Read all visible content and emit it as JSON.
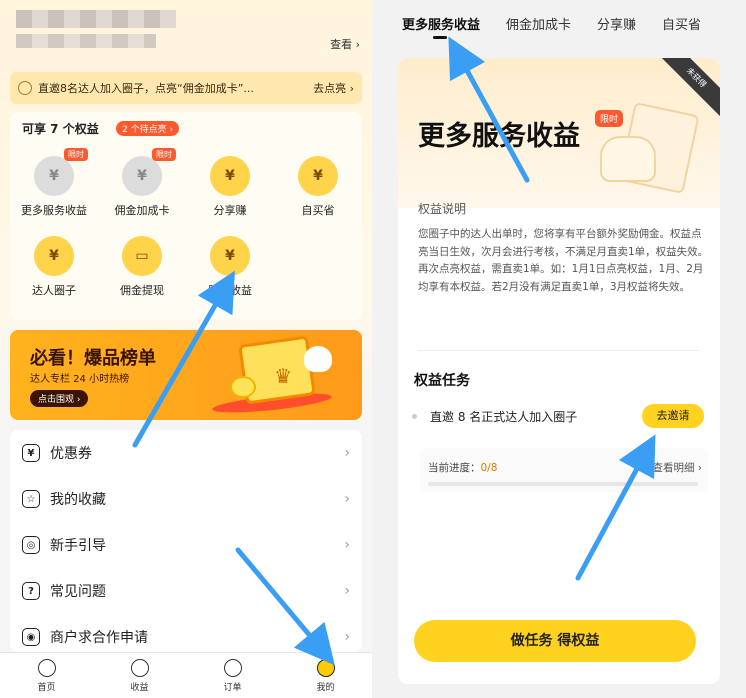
{
  "left": {
    "header": {
      "view_label": "查看 ›"
    },
    "invite_bar": {
      "text": "直邀8名达人加入圈子，点亮“佣金加成卡”...",
      "action": "去点亮 ›"
    },
    "benefits": {
      "heading": "可享 7 个权益",
      "pending_badge": "2 个待点亮 ›",
      "limited_label": "限时",
      "items": [
        {
          "label": "更多服务收益",
          "icon": "¥",
          "limited": true,
          "style": "gray"
        },
        {
          "label": "佣金加成卡",
          "icon": "¥",
          "limited": true,
          "style": "gray"
        },
        {
          "label": "分享赚",
          "icon": "¥",
          "limited": false,
          "style": "yellow"
        },
        {
          "label": "自买省",
          "icon": "¥",
          "limited": false,
          "style": "yellow"
        },
        {
          "label": "达人圈子",
          "icon": "¥",
          "limited": false,
          "style": "yellow"
        },
        {
          "label": "佣金提现",
          "icon": "▭",
          "limited": false,
          "style": "yellow"
        },
        {
          "label": "服务收益",
          "icon": "¥",
          "limited": false,
          "style": "yellow"
        }
      ]
    },
    "banner": {
      "title": "必看！爆品榜单",
      "subtitle": "达人专栏 24 小时热榜",
      "button": "点击围观 ›"
    },
    "menu": [
      {
        "label": "优惠券",
        "icon": "coupon-icon",
        "glyph": "¥"
      },
      {
        "label": "我的收藏",
        "icon": "star-icon",
        "glyph": "☆"
      },
      {
        "label": "新手引导",
        "icon": "compass-icon",
        "glyph": "◎"
      },
      {
        "label": "常见问题",
        "icon": "question-icon",
        "glyph": "?"
      },
      {
        "label": "商户求合作申请",
        "icon": "handshake-icon",
        "glyph": "◉"
      }
    ],
    "tabbar": [
      {
        "label": "首页",
        "active": false
      },
      {
        "label": "收益",
        "active": false
      },
      {
        "label": "订单",
        "active": false
      },
      {
        "label": "我的",
        "active": true
      }
    ]
  },
  "right": {
    "tabs": [
      "更多服务收益",
      "佣金加成卡",
      "分享赚",
      "自买省"
    ],
    "active_tab": 0,
    "corner_ribbon": "未获得",
    "title": "更多服务收益",
    "limited_label": "限时",
    "description_heading": "权益说明",
    "description": "您圈子中的达人出单时，您将享有平台额外奖励佣金。权益点亮当日生效，次月会进行考核，不满足月直卖1单，权益失效。再次点亮权益，需直卖1单。如：1月1日点亮权益，1月、2月均享有本权益。若2月没有满足直卖1单，3月权益将失效。",
    "tasks_heading": "权益任务",
    "task": {
      "text": "直邀 8 名正式达人加入圈子",
      "button": "去邀请",
      "progress_label": "当前进度：",
      "progress_value": "0/8",
      "progress_fraction": 0,
      "detail_link": "查看明细 ›"
    },
    "cta": "做任务 得权益"
  },
  "colors": {
    "accent": "#ffd21f",
    "badge": "#ff5a2e",
    "arrow": "#3a9ef5"
  }
}
